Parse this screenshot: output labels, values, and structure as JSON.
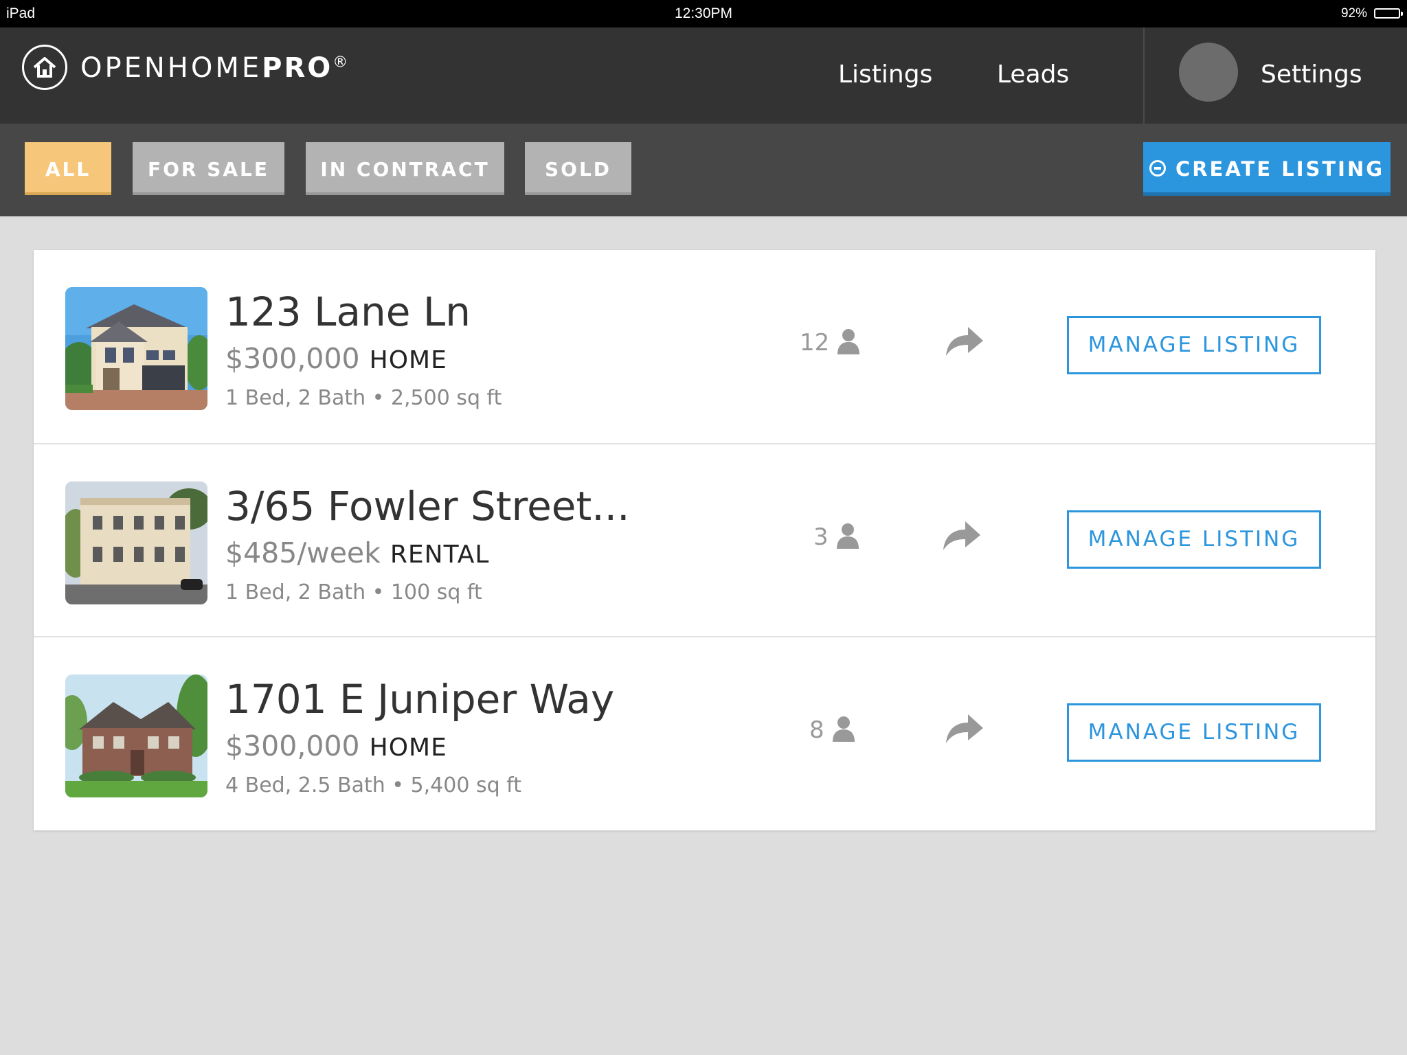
{
  "status_bar": {
    "device": "iPad",
    "time": "12:30PM",
    "battery": "92%"
  },
  "nav": {
    "brand_light": "OPENHOME",
    "brand_bold": "PRO",
    "brand_mark": "®",
    "links": [
      "Listings",
      "Leads",
      "Settings"
    ]
  },
  "filters": {
    "all": "ALL",
    "for_sale": "FOR SALE",
    "in_contract": "IN CONTRACT",
    "sold": "SOLD",
    "active": "ALL",
    "create_label": "CREATE LISTING"
  },
  "listings": [
    {
      "address": "123 Lane Ln",
      "price": "$300,000",
      "type": "HOME",
      "details": "1 Bed, 2 Bath • 2,500 sq ft",
      "leads": "12",
      "action": "MANAGE LISTING"
    },
    {
      "address": "3/65 Fowler Street...",
      "price": "$485/week",
      "type": "RENTAL",
      "details": "1 Bed, 2 Bath  •  100 sq ft",
      "leads": "3",
      "action": "MANAGE LISTING"
    },
    {
      "address": "1701 E Juniper Way",
      "price": "$300,000",
      "type": "HOME",
      "details": "4 Bed, 2.5 Bath • 5,400 sq ft",
      "leads": "8",
      "action": "MANAGE LISTING"
    }
  ],
  "colors": {
    "accent_blue": "#2b95de",
    "active_filter": "#f6c77a",
    "nav_bg": "#333333"
  }
}
